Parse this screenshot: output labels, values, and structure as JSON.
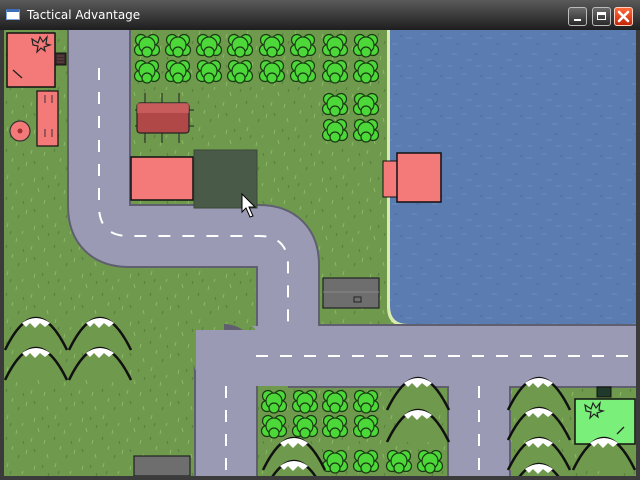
{
  "window": {
    "title": "Tactical Advantage",
    "icons": {
      "app": "window-app-icon",
      "minimize": "minimize-icon",
      "maximize": "maximize-icon",
      "close": "close-icon"
    }
  },
  "colors": {
    "grass": "#6f9a4e",
    "road": "#9a9ab4",
    "road_edge": "#5f5f70",
    "lake": "#5a7cb0",
    "lake_shore": "#d8ecb0",
    "red_unit": "#f47a7a",
    "green_unit": "#7af07a",
    "tree": "#4dd83a",
    "selection": "#4a5a48",
    "gray_structure": "#6e6e6e"
  },
  "map": {
    "icons": {
      "red_hq": "eagle-emblem-icon",
      "green_hq": "eagle-emblem-icon",
      "target": "target-icon",
      "cursor": "mouse-pointer-icon",
      "tree": "tree-icon",
      "mountain": "snowy-mountain-icon"
    }
  }
}
